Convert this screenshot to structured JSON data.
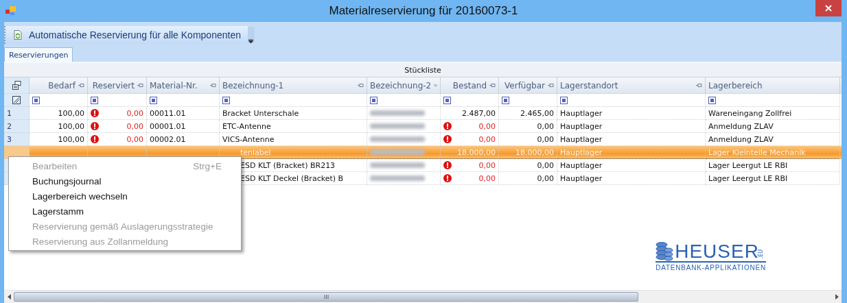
{
  "window": {
    "title": "Materialreservierung für 20160073-1"
  },
  "toolbar": {
    "button": "Automatische Reservierung für alle Komponenten"
  },
  "tabs": [
    {
      "label": "Reservierungen",
      "selected": true
    }
  ],
  "grid": {
    "group_header": "Stückliste",
    "columns": [
      "Bedarf",
      "Reserviert",
      "Material-Nr.",
      "Bezeichnung-1",
      "Bezeichnung-2",
      "Bestand",
      "Verfügbar",
      "Lagerstandort",
      "Lagerbereich"
    ],
    "rows": [
      {
        "number": "1",
        "selected": false,
        "bedarf": "100,00",
        "reserviert": {
          "text": "0,00",
          "warning": true
        },
        "material": "00011.01",
        "bez1": "Bracket Unterschale",
        "bestand": {
          "text": "2.487,00",
          "warning": false
        },
        "verfuegbar": "2.465,00",
        "standort": "Hauptlager",
        "bereich": "Wareneingang Zollfrei"
      },
      {
        "number": "2",
        "selected": false,
        "bedarf": "100,00",
        "reserviert": {
          "text": "0,00",
          "warning": true
        },
        "material": "00001.01",
        "bez1": "ETC-Antenne",
        "bestand": {
          "text": "0,00",
          "warning": true
        },
        "verfuegbar": "0,00",
        "standort": "Hauptlager",
        "bereich": "Anmeldung ZLAV"
      },
      {
        "number": "3",
        "selected": false,
        "bedarf": "100,00",
        "reserviert": {
          "text": "0,00",
          "warning": true
        },
        "material": "00002.01",
        "bez1": "VICS-Antenne",
        "bestand": {
          "text": "0,00",
          "warning": true
        },
        "verfuegbar": "0,00",
        "standort": "Hauptlager",
        "bereich": "Anmeldung ZLAV"
      },
      {
        "selected": true,
        "bez1": "tenlabel",
        "bestand": {
          "text": "18.000,00",
          "warning": false
        },
        "verfuegbar": "18.000,00",
        "standort": "Hauptlager",
        "bereich": "Lager Kleinteile Mechanik"
      },
      {
        "selected": false,
        "bez1": "ESD KLT (Bracket) BR213",
        "bestand": {
          "text": "0,00",
          "warning": true
        },
        "verfuegbar": "0,00",
        "standort": "Hauptlager",
        "bereich": "Lager Leergut LE RBI"
      },
      {
        "selected": false,
        "bez1": "ESD KLT Deckel (Bracket) B",
        "bestand": {
          "text": "0,00",
          "warning": true
        },
        "verfuegbar": "0,00",
        "standort": "Hauptlager",
        "bereich": "Lager Leergut LE RBI"
      }
    ]
  },
  "context_menu": [
    {
      "label": "Bearbeiten",
      "shortcut": "Strg+E",
      "disabled": true
    },
    {
      "label": "Buchungsjournal",
      "disabled": false
    },
    {
      "label": "Lagerbereich wechseln",
      "disabled": false
    },
    {
      "label": "Lagerstamm",
      "disabled": false
    },
    {
      "label": "Reservierung gemäß Auslagerungsstrategie",
      "disabled": true
    },
    {
      "label": "Reservierung aus Zollanmeldung",
      "disabled": true
    }
  ],
  "logo": {
    "name": "HEUSER",
    "suffix": ".EU",
    "tagline": "DATENBANK-APPLIKATIONEN"
  }
}
